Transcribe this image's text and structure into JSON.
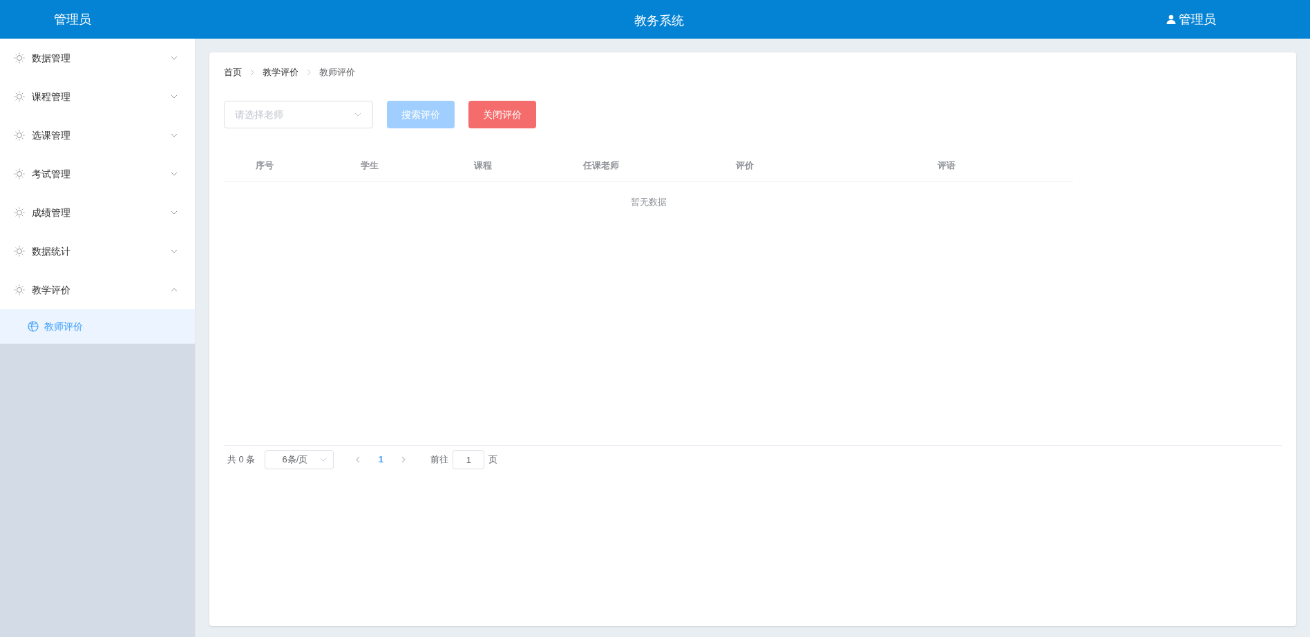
{
  "header": {
    "brand": "管理员",
    "title": "教务系统",
    "user": "管理员"
  },
  "sidebar": {
    "items": [
      {
        "label": "数据管理",
        "expanded": false
      },
      {
        "label": "课程管理",
        "expanded": false
      },
      {
        "label": "选课管理",
        "expanded": false
      },
      {
        "label": "考试管理",
        "expanded": false
      },
      {
        "label": "成绩管理",
        "expanded": false
      },
      {
        "label": "数据统计",
        "expanded": false
      },
      {
        "label": "教学评价",
        "expanded": true,
        "children": [
          {
            "label": "教师评价",
            "selected": true
          }
        ]
      }
    ]
  },
  "breadcrumb": [
    "首页",
    "教学评价",
    "教师评价"
  ],
  "toolbar": {
    "teacher_select": {
      "placeholder": "请选择老师"
    },
    "buttons": [
      {
        "label": "搜索评价",
        "kind": "primary",
        "disabled": true
      },
      {
        "label": "关闭评价",
        "kind": "danger",
        "disabled": false
      }
    ]
  },
  "table": {
    "columns": [
      "序号",
      "学生",
      "课程",
      "任课老师",
      "评价",
      "评语"
    ],
    "empty_text": "暂无数据"
  },
  "pagination": {
    "total": "共 0 条",
    "page_size": "6条/页",
    "pages": [
      {
        "label": "1",
        "selected": true
      }
    ],
    "goto_label": "前往",
    "goto_value": "1",
    "page_suffix": "页"
  }
}
